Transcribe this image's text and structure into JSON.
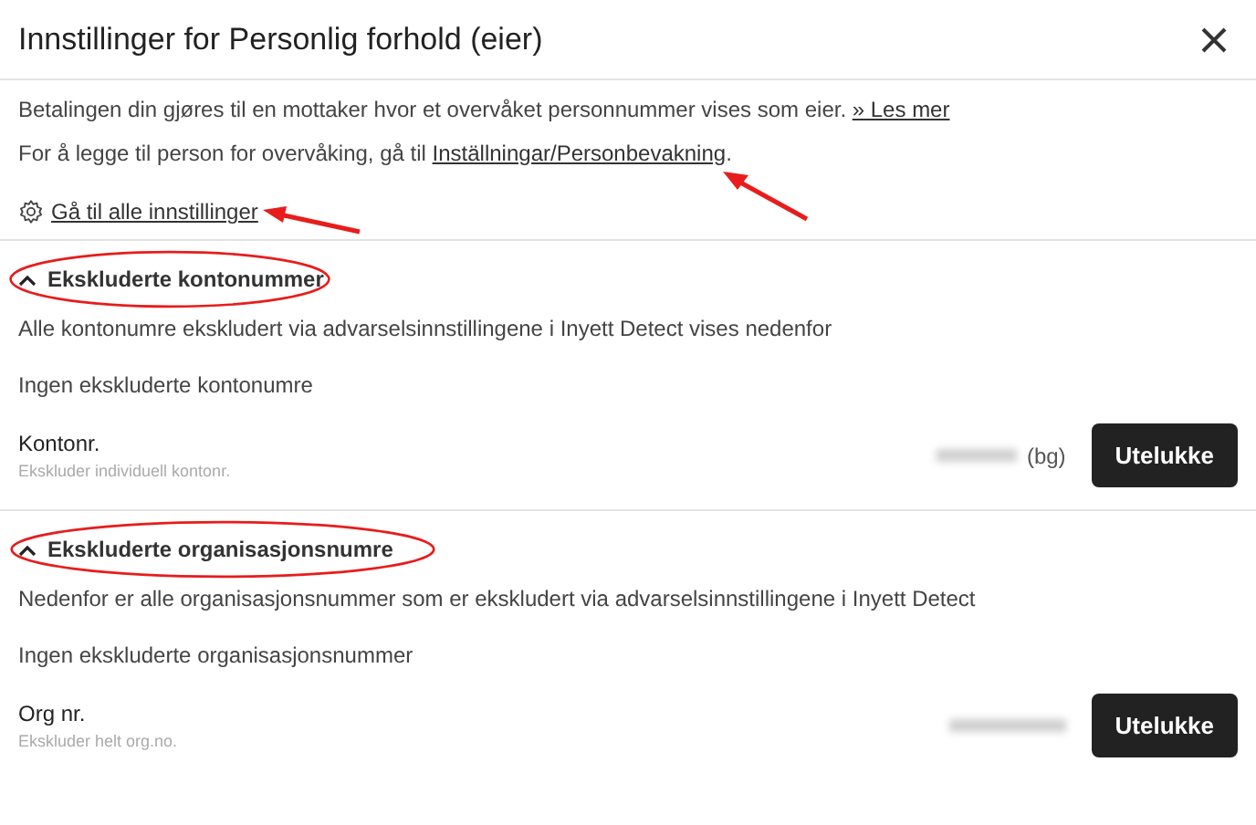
{
  "window": {
    "title": "Innstillinger for Personlig forhold (eier)"
  },
  "intro": {
    "paragraphs": [
      {
        "before": "Betalingen din gjøres til en mottaker hvor et overvåket personnummer vises som eier. ",
        "link": "» Les mer"
      },
      {
        "before": "For å legge til person for overvåking, gå til ",
        "link": "Inställningar/Personbevakning",
        "after": "."
      }
    ],
    "settings_link": "Gå til alle innstillinger"
  },
  "sections": [
    {
      "title": "Ekskluderte kontonummer",
      "expanded": true,
      "highlighted": true,
      "description": "Alle kontonumre ekskludert via advarselsinnstillingene i Inyett Detect vises nedenfor",
      "empty_text": "Ingen ekskluderte kontonumre",
      "field_label": "Kontonr.",
      "field_hint": "Ekskluder individuell kontonr.",
      "value_suffix": "(bg)",
      "button": "Utelukke"
    },
    {
      "title": "Ekskluderte organisasjonsnumre",
      "expanded": true,
      "highlighted": true,
      "description": "Nedenfor er alle organisasjonsnummer som er ekskludert via advarselsinnstillingene i Inyett Detect",
      "empty_text": "Ingen ekskluderte organisasjonsnummer",
      "field_label": "Org nr.",
      "field_hint": "Ekskluder helt org.no.",
      "button": "Utelukke"
    }
  ]
}
